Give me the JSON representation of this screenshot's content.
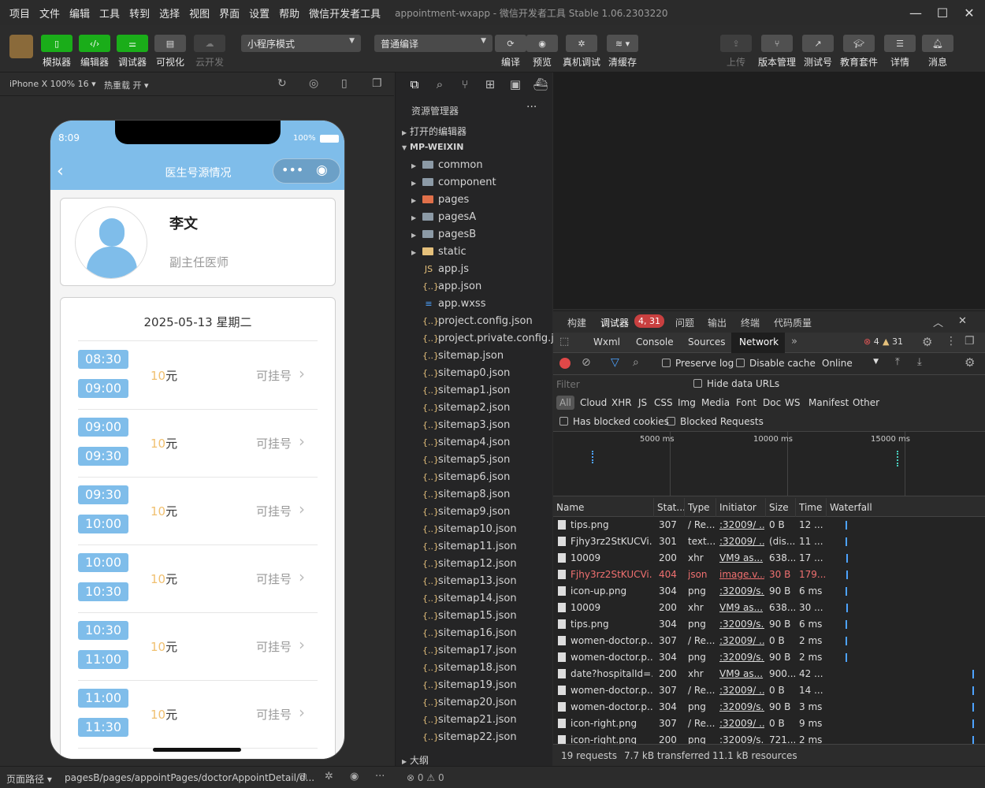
{
  "titlebar": {
    "menu": [
      "项目",
      "文件",
      "编辑",
      "工具",
      "转到",
      "选择",
      "视图",
      "界面",
      "设置",
      "帮助",
      "微信开发者工具"
    ],
    "title": "appointment-wxapp - 微信开发者工具 Stable 1.06.2303220",
    "minimize": "—",
    "maximize": "☐",
    "close": "✕"
  },
  "toolbar": {
    "simulator": "模拟器",
    "editor": "编辑器",
    "debugger": "调试器",
    "visual": "可视化",
    "cloud": "云开发",
    "mode": "小程序模式",
    "compile_mode": "普通编译",
    "compile": "编译",
    "preview": "预览",
    "real_debug": "真机调试",
    "clear_cache": "清缓存",
    "upload": "上传",
    "version": "版本管理",
    "test": "测试号",
    "edu": "教育套件",
    "details": "详情",
    "messages": "消息"
  },
  "simbar": {
    "device": "iPhone X 100% 16",
    "hot_reload": "热重载 开"
  },
  "phone": {
    "time": "8:09",
    "battery": "100%",
    "nav_title": "医生号源情况",
    "doctor_name": "李文",
    "doctor_title": "副主任医师",
    "date": "2025-05-13 星期二",
    "price_num": "10",
    "price_unit": "元",
    "avail": "可挂号",
    "slots": [
      {
        "start": "08:30",
        "end": "09:00"
      },
      {
        "start": "09:00",
        "end": "09:30"
      },
      {
        "start": "09:30",
        "end": "10:00"
      },
      {
        "start": "10:00",
        "end": "10:30"
      },
      {
        "start": "10:30",
        "end": "11:00"
      },
      {
        "start": "11:00",
        "end": "11:30"
      }
    ]
  },
  "explorer": {
    "title": "资源管理器",
    "open_editors": "打开的编辑器",
    "root": "MP-WEIXIN",
    "outline": "大纲",
    "folders": [
      "common",
      "component",
      "pages",
      "pagesA",
      "pagesB",
      "static"
    ],
    "files": [
      "app.js",
      "app.json",
      "app.wxss",
      "project.config.json",
      "project.private.config.js...",
      "sitemap.json",
      "sitemap0.json",
      "sitemap1.json",
      "sitemap2.json",
      "sitemap3.json",
      "sitemap4.json",
      "sitemap5.json",
      "sitemap6.json",
      "sitemap8.json",
      "sitemap9.json",
      "sitemap10.json",
      "sitemap11.json",
      "sitemap12.json",
      "sitemap13.json",
      "sitemap14.json",
      "sitemap15.json",
      "sitemap16.json",
      "sitemap17.json",
      "sitemap18.json",
      "sitemap19.json",
      "sitemap20.json",
      "sitemap21.json",
      "sitemap22.json"
    ]
  },
  "devtools": {
    "tabs": [
      "构建",
      "调试器",
      "问题",
      "输出",
      "终端",
      "代码质量"
    ],
    "debugger_badge": "4, 31",
    "subtabs": [
      "Wxml",
      "Console",
      "Sources",
      "Network"
    ],
    "errors": "4",
    "warnings": "31",
    "preserve_log": "Preserve log",
    "disable_cache": "Disable cache",
    "throttle": "Online",
    "filter_placeholder": "Filter",
    "hide_data_urls": "Hide data URLs",
    "types": [
      "All",
      "Cloud",
      "XHR",
      "JS",
      "CSS",
      "Img",
      "Media",
      "Font",
      "Doc",
      "WS",
      "Manifest",
      "Other"
    ],
    "has_blocked_cookies": "Has blocked cookies",
    "blocked_requests": "Blocked Requests",
    "timeline": [
      "5000 ms",
      "10000 ms",
      "15000 ms"
    ],
    "columns": [
      "Name",
      "Stat...",
      "Type",
      "Initiator",
      "Size",
      "Time",
      "Waterfall"
    ],
    "rows": [
      {
        "name": "tips.png",
        "status": "307",
        "type": "/ Re...",
        "initiator": ":32009/ ...",
        "size": "0 B",
        "time": "12 ..."
      },
      {
        "name": "Fjhy3rz2StKUCVi...",
        "status": "301",
        "type": "text...",
        "initiator": ":32009/ ...",
        "size": "(dis...",
        "time": "11 ..."
      },
      {
        "name": "10009",
        "status": "200",
        "type": "xhr",
        "initiator": "VM9 as...",
        "size": "638...",
        "time": "17 ..."
      },
      {
        "name": "Fjhy3rz2StKUCVi...",
        "status": "404",
        "type": "json",
        "initiator": "image.v...",
        "size": "30 B",
        "time": "179...",
        "error": true
      },
      {
        "name": "icon-up.png",
        "status": "304",
        "type": "png",
        "initiator": ":32009/s...",
        "size": "90 B",
        "time": "6 ms"
      },
      {
        "name": "10009",
        "status": "200",
        "type": "xhr",
        "initiator": "VM9 as...",
        "size": "638...",
        "time": "30 ..."
      },
      {
        "name": "tips.png",
        "status": "304",
        "type": "png",
        "initiator": ":32009/s...",
        "size": "90 B",
        "time": "6 ms"
      },
      {
        "name": "women-doctor.p...",
        "status": "307",
        "type": "/ Re...",
        "initiator": ":32009/ ...",
        "size": "0 B",
        "time": "2 ms"
      },
      {
        "name": "women-doctor.p...",
        "status": "304",
        "type": "png",
        "initiator": ":32009/s...",
        "size": "90 B",
        "time": "2 ms"
      },
      {
        "name": "date?hospitalId=...",
        "status": "200",
        "type": "xhr",
        "initiator": "VM9 as...",
        "size": "900...",
        "time": "42 ..."
      },
      {
        "name": "women-doctor.p...",
        "status": "307",
        "type": "/ Re...",
        "initiator": ":32009/ ...",
        "size": "0 B",
        "time": "14 ..."
      },
      {
        "name": "women-doctor.p...",
        "status": "304",
        "type": "png",
        "initiator": ":32009/s...",
        "size": "90 B",
        "time": "3 ms"
      },
      {
        "name": "icon-right.png",
        "status": "307",
        "type": "/ Re...",
        "initiator": ":32009/ ...",
        "size": "0 B",
        "time": "9 ms"
      },
      {
        "name": "icon-right.png",
        "status": "200",
        "type": "png",
        "initiator": ":32009/s...",
        "size": "721...",
        "time": "2 ms"
      }
    ],
    "status": {
      "requests": "19 requests",
      "transferred": "7.7 kB transferred",
      "resources": "11.1 kB resources"
    }
  },
  "statusbar": {
    "page_path_label": "页面路径",
    "path": "pagesB/pages/appointPages/doctorAppointDetail/d...",
    "errors": "0",
    "warnings": "0"
  },
  "colors": {
    "accent": "#1aad19",
    "nav": "#7fbdea",
    "error": "#f07070"
  }
}
